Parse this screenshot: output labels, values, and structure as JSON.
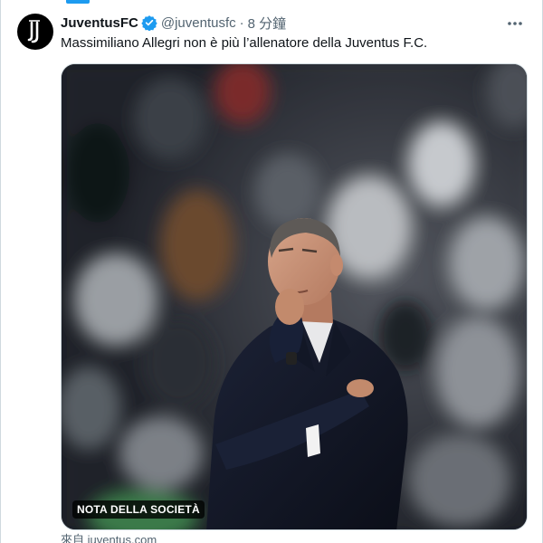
{
  "account": {
    "display_name": "JuventusFC",
    "handle": "@juventusfc",
    "separator": "·",
    "time": "8 分鐘"
  },
  "tweet": {
    "text": "Massimiliano Allegri non è più l’allenatore della Juventus F.C."
  },
  "media": {
    "badge": "NOTA DELLA SOCIETÀ"
  },
  "card": {
    "source": "來自 juventus.com"
  },
  "icons": {
    "avatar": "juventus-logo-icon",
    "verified": "verified-badge-icon",
    "more": "more-icon"
  },
  "colors": {
    "accent": "#1d9bf0",
    "text": "#0f1419",
    "secondary_text": "#536471"
  }
}
